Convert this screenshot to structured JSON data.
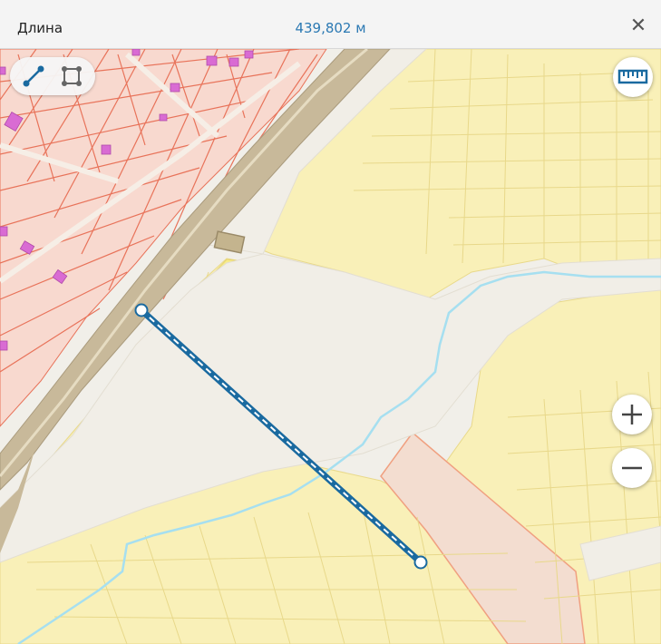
{
  "measure_bar": {
    "title": "Длина",
    "value": "439,802 м"
  },
  "toolbar": {
    "tools": [
      {
        "icon": "line-measure-icon",
        "active": true
      },
      {
        "icon": "area-measure-icon",
        "active": false
      }
    ]
  },
  "controls": {
    "ruler_icon": "ruler-icon",
    "zoom_in_icon": "plus-icon",
    "zoom_out_icon": "minus-icon"
  },
  "colors": {
    "accent": "#2b79b3",
    "measure_line": "#1a6aa0",
    "parcel_yellow": "#f9f0b8",
    "parcel_yellow_bright": "#f8ec8a",
    "parcel_red_border": "#e8735a",
    "parcel_pink": "#f3ddd0",
    "road": "#f1eee7",
    "rail": "#c8b99a",
    "river": "#a6dff0",
    "building": "#d96bd3"
  },
  "measurement": {
    "segment_count": 1
  }
}
